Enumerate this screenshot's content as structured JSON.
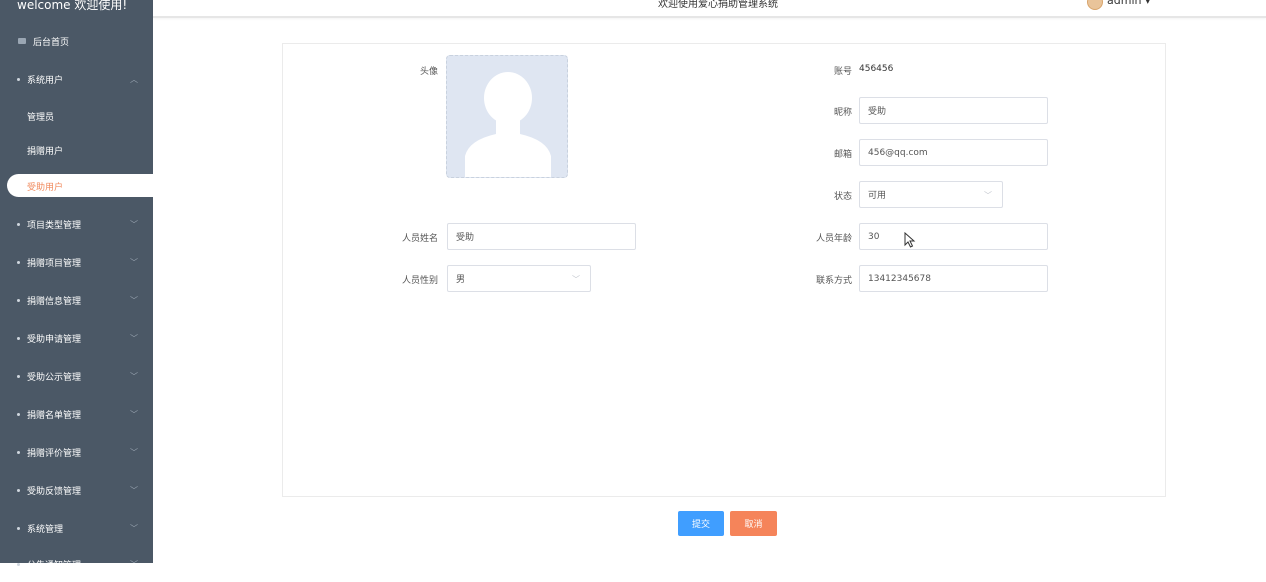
{
  "sidebar": {
    "brand": "welcome 欢迎使用!",
    "home": "后台首页",
    "system_users": "系统用户",
    "sub_items": [
      "管理员",
      "捐赠用户",
      "受助用户"
    ],
    "active_item": "受助用户",
    "menus": [
      "项目类型管理",
      "捐赠项目管理",
      "捐赠信息管理",
      "受助申请管理",
      "受助公示管理",
      "捐赠名单管理",
      "捐赠评价管理",
      "受助反馈管理",
      "系统管理",
      "公告通知管理"
    ]
  },
  "header": {
    "title": "欢迎使用爱心捐助管理系统",
    "user": "admin"
  },
  "form": {
    "avatar_label": "头像",
    "account_label": "账号",
    "account_value": "456456",
    "nickname_label": "昵称",
    "nickname_value": "受助",
    "email_label": "邮箱",
    "email_value": "456@qq.com",
    "status_label": "状态",
    "status_value": "可用",
    "name_label": "人员姓名",
    "name_value": "受助",
    "age_label": "人员年龄",
    "age_value": "30",
    "gender_label": "人员性别",
    "gender_value": "男",
    "contact_label": "联系方式",
    "contact_value": "13412345678"
  },
  "buttons": {
    "submit": "提交",
    "cancel": "取消"
  },
  "colors": {
    "sidebar_bg": "#4b5866",
    "active_text": "#f08a5d",
    "submit": "#409eff",
    "cancel": "#f5845a"
  }
}
